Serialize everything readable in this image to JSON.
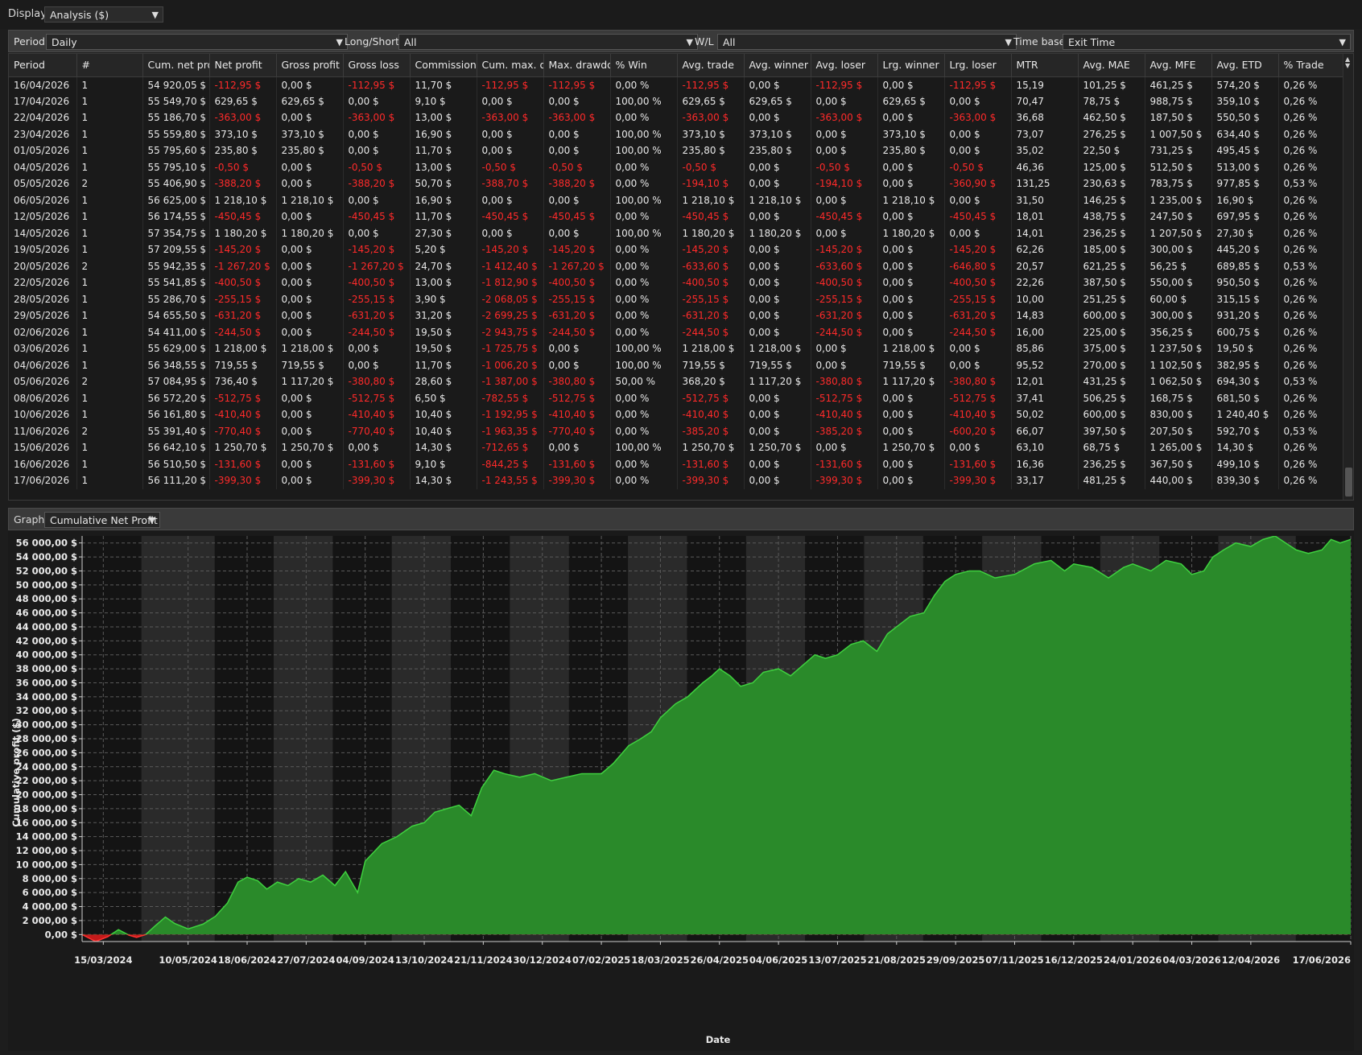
{
  "display": {
    "label": "Display",
    "value": "Analysis ($)"
  },
  "filters": {
    "period_label": "Period",
    "period_value": "Daily",
    "longshort_label": "Long/Short",
    "longshort_value": "All",
    "wl_label": "W/L",
    "wl_value": "All",
    "timebase_label": "Time base",
    "timebase_value": "Exit Time"
  },
  "table": {
    "columns": [
      "Period",
      "#",
      "Cum. net pro",
      "Net profit",
      "Gross profit",
      "Gross loss",
      "Commission",
      "Cum. max. dr",
      "Max. drawdow",
      "% Win",
      "Avg. trade",
      "Avg. winner",
      "Avg. loser",
      "Lrg. winner",
      "Lrg. loser",
      "MTR",
      "Avg. MAE",
      "Avg. MFE",
      "Avg. ETD",
      "% Trade"
    ],
    "rows": [
      [
        "16/04/2026",
        "1",
        "54 920,05 $",
        "-112,95 $",
        "0,00 $",
        "-112,95 $",
        "11,70 $",
        "-112,95 $",
        "-112,95 $",
        "0,00 %",
        "-112,95 $",
        "0,00 $",
        "-112,95 $",
        "0,00 $",
        "-112,95 $",
        "15,19",
        "101,25 $",
        "461,25 $",
        "574,20 $",
        "0,26 %"
      ],
      [
        "17/04/2026",
        "1",
        "55 549,70 $",
        "629,65 $",
        "629,65 $",
        "0,00 $",
        "9,10 $",
        "0,00 $",
        "0,00 $",
        "100,00 %",
        "629,65 $",
        "629,65 $",
        "0,00 $",
        "629,65 $",
        "0,00 $",
        "70,47",
        "78,75 $",
        "988,75 $",
        "359,10 $",
        "0,26 %"
      ],
      [
        "22/04/2026",
        "1",
        "55 186,70 $",
        "-363,00 $",
        "0,00 $",
        "-363,00 $",
        "13,00 $",
        "-363,00 $",
        "-363,00 $",
        "0,00 %",
        "-363,00 $",
        "0,00 $",
        "-363,00 $",
        "0,00 $",
        "-363,00 $",
        "36,68",
        "462,50 $",
        "187,50 $",
        "550,50 $",
        "0,26 %"
      ],
      [
        "23/04/2026",
        "1",
        "55 559,80 $",
        "373,10 $",
        "373,10 $",
        "0,00 $",
        "16,90 $",
        "0,00 $",
        "0,00 $",
        "100,00 %",
        "373,10 $",
        "373,10 $",
        "0,00 $",
        "373,10 $",
        "0,00 $",
        "73,07",
        "276,25 $",
        "1 007,50 $",
        "634,40 $",
        "0,26 %"
      ],
      [
        "01/05/2026",
        "1",
        "55 795,60 $",
        "235,80 $",
        "235,80 $",
        "0,00 $",
        "11,70 $",
        "0,00 $",
        "0,00 $",
        "100,00 %",
        "235,80 $",
        "235,80 $",
        "0,00 $",
        "235,80 $",
        "0,00 $",
        "35,02",
        "22,50 $",
        "731,25 $",
        "495,45 $",
        "0,26 %"
      ],
      [
        "04/05/2026",
        "1",
        "55 795,10 $",
        "-0,50 $",
        "0,00 $",
        "-0,50 $",
        "13,00 $",
        "-0,50 $",
        "-0,50 $",
        "0,00 %",
        "-0,50 $",
        "0,00 $",
        "-0,50 $",
        "0,00 $",
        "-0,50 $",
        "46,36",
        "125,00 $",
        "512,50 $",
        "513,00 $",
        "0,26 %"
      ],
      [
        "05/05/2026",
        "2",
        "55 406,90 $",
        "-388,20 $",
        "0,00 $",
        "-388,20 $",
        "50,70 $",
        "-388,70 $",
        "-388,20 $",
        "0,00 %",
        "-194,10 $",
        "0,00 $",
        "-194,10 $",
        "0,00 $",
        "-360,90 $",
        "131,25",
        "230,63 $",
        "783,75 $",
        "977,85 $",
        "0,53 %"
      ],
      [
        "06/05/2026",
        "1",
        "56 625,00 $",
        "1 218,10 $",
        "1 218,10 $",
        "0,00 $",
        "16,90 $",
        "0,00 $",
        "0,00 $",
        "100,00 %",
        "1 218,10 $",
        "1 218,10 $",
        "0,00 $",
        "1 218,10 $",
        "0,00 $",
        "31,50",
        "146,25 $",
        "1 235,00 $",
        "16,90 $",
        "0,26 %"
      ],
      [
        "12/05/2026",
        "1",
        "56 174,55 $",
        "-450,45 $",
        "0,00 $",
        "-450,45 $",
        "11,70 $",
        "-450,45 $",
        "-450,45 $",
        "0,00 %",
        "-450,45 $",
        "0,00 $",
        "-450,45 $",
        "0,00 $",
        "-450,45 $",
        "18,01",
        "438,75 $",
        "247,50 $",
        "697,95 $",
        "0,26 %"
      ],
      [
        "14/05/2026",
        "1",
        "57 354,75 $",
        "1 180,20 $",
        "1 180,20 $",
        "0,00 $",
        "27,30 $",
        "0,00 $",
        "0,00 $",
        "100,00 %",
        "1 180,20 $",
        "1 180,20 $",
        "0,00 $",
        "1 180,20 $",
        "0,00 $",
        "14,01",
        "236,25 $",
        "1 207,50 $",
        "27,30 $",
        "0,26 %"
      ],
      [
        "19/05/2026",
        "1",
        "57 209,55 $",
        "-145,20 $",
        "0,00 $",
        "-145,20 $",
        "5,20 $",
        "-145,20 $",
        "-145,20 $",
        "0,00 %",
        "-145,20 $",
        "0,00 $",
        "-145,20 $",
        "0,00 $",
        "-145,20 $",
        "62,26",
        "185,00 $",
        "300,00 $",
        "445,20 $",
        "0,26 %"
      ],
      [
        "20/05/2026",
        "2",
        "55 942,35 $",
        "-1 267,20 $",
        "0,00 $",
        "-1 267,20 $",
        "24,70 $",
        "-1 412,40 $",
        "-1 267,20 $",
        "0,00 %",
        "-633,60 $",
        "0,00 $",
        "-633,60 $",
        "0,00 $",
        "-646,80 $",
        "20,57",
        "621,25 $",
        "56,25 $",
        "689,85 $",
        "0,53 %"
      ],
      [
        "22/05/2026",
        "1",
        "55 541,85 $",
        "-400,50 $",
        "0,00 $",
        "-400,50 $",
        "13,00 $",
        "-1 812,90 $",
        "-400,50 $",
        "0,00 %",
        "-400,50 $",
        "0,00 $",
        "-400,50 $",
        "0,00 $",
        "-400,50 $",
        "22,26",
        "387,50 $",
        "550,00 $",
        "950,50 $",
        "0,26 %"
      ],
      [
        "28/05/2026",
        "1",
        "55 286,70 $",
        "-255,15 $",
        "0,00 $",
        "-255,15 $",
        "3,90 $",
        "-2 068,05 $",
        "-255,15 $",
        "0,00 %",
        "-255,15 $",
        "0,00 $",
        "-255,15 $",
        "0,00 $",
        "-255,15 $",
        "10,00",
        "251,25 $",
        "60,00 $",
        "315,15 $",
        "0,26 %"
      ],
      [
        "29/05/2026",
        "1",
        "54 655,50 $",
        "-631,20 $",
        "0,00 $",
        "-631,20 $",
        "31,20 $",
        "-2 699,25 $",
        "-631,20 $",
        "0,00 %",
        "-631,20 $",
        "0,00 $",
        "-631,20 $",
        "0,00 $",
        "-631,20 $",
        "14,83",
        "600,00 $",
        "300,00 $",
        "931,20 $",
        "0,26 %"
      ],
      [
        "02/06/2026",
        "1",
        "54 411,00 $",
        "-244,50 $",
        "0,00 $",
        "-244,50 $",
        "19,50 $",
        "-2 943,75 $",
        "-244,50 $",
        "0,00 %",
        "-244,50 $",
        "0,00 $",
        "-244,50 $",
        "0,00 $",
        "-244,50 $",
        "16,00",
        "225,00 $",
        "356,25 $",
        "600,75 $",
        "0,26 %"
      ],
      [
        "03/06/2026",
        "1",
        "55 629,00 $",
        "1 218,00 $",
        "1 218,00 $",
        "0,00 $",
        "19,50 $",
        "-1 725,75 $",
        "0,00 $",
        "100,00 %",
        "1 218,00 $",
        "1 218,00 $",
        "0,00 $",
        "1 218,00 $",
        "0,00 $",
        "85,86",
        "375,00 $",
        "1 237,50 $",
        "19,50 $",
        "0,26 %"
      ],
      [
        "04/06/2026",
        "1",
        "56 348,55 $",
        "719,55 $",
        "719,55 $",
        "0,00 $",
        "11,70 $",
        "-1 006,20 $",
        "0,00 $",
        "100,00 %",
        "719,55 $",
        "719,55 $",
        "0,00 $",
        "719,55 $",
        "0,00 $",
        "95,52",
        "270,00 $",
        "1 102,50 $",
        "382,95 $",
        "0,26 %"
      ],
      [
        "05/06/2026",
        "2",
        "57 084,95 $",
        "736,40 $",
        "1 117,20 $",
        "-380,80 $",
        "28,60 $",
        "-1 387,00 $",
        "-380,80 $",
        "50,00 %",
        "368,20 $",
        "1 117,20 $",
        "-380,80 $",
        "1 117,20 $",
        "-380,80 $",
        "12,01",
        "431,25 $",
        "1 062,50 $",
        "694,30 $",
        "0,53 %"
      ],
      [
        "08/06/2026",
        "1",
        "56 572,20 $",
        "-512,75 $",
        "0,00 $",
        "-512,75 $",
        "6,50 $",
        "-782,55 $",
        "-512,75 $",
        "0,00 %",
        "-512,75 $",
        "0,00 $",
        "-512,75 $",
        "0,00 $",
        "-512,75 $",
        "37,41",
        "506,25 $",
        "168,75 $",
        "681,50 $",
        "0,26 %"
      ],
      [
        "10/06/2026",
        "1",
        "56 161,80 $",
        "-410,40 $",
        "0,00 $",
        "-410,40 $",
        "10,40 $",
        "-1 192,95 $",
        "-410,40 $",
        "0,00 %",
        "-410,40 $",
        "0,00 $",
        "-410,40 $",
        "0,00 $",
        "-410,40 $",
        "50,02",
        "600,00 $",
        "830,00 $",
        "1 240,40 $",
        "0,26 %"
      ],
      [
        "11/06/2026",
        "2",
        "55 391,40 $",
        "-770,40 $",
        "0,00 $",
        "-770,40 $",
        "10,40 $",
        "-1 963,35 $",
        "-770,40 $",
        "0,00 %",
        "-385,20 $",
        "0,00 $",
        "-385,20 $",
        "0,00 $",
        "-600,20 $",
        "66,07",
        "397,50 $",
        "207,50 $",
        "592,70 $",
        "0,53 %"
      ],
      [
        "15/06/2026",
        "1",
        "56 642,10 $",
        "1 250,70 $",
        "1 250,70 $",
        "0,00 $",
        "14,30 $",
        "-712,65 $",
        "0,00 $",
        "100,00 %",
        "1 250,70 $",
        "1 250,70 $",
        "0,00 $",
        "1 250,70 $",
        "0,00 $",
        "63,10",
        "68,75 $",
        "1 265,00 $",
        "14,30 $",
        "0,26 %"
      ],
      [
        "16/06/2026",
        "1",
        "56 510,50 $",
        "-131,60 $",
        "0,00 $",
        "-131,60 $",
        "9,10 $",
        "-844,25 $",
        "-131,60 $",
        "0,00 %",
        "-131,60 $",
        "0,00 $",
        "-131,60 $",
        "0,00 $",
        "-131,60 $",
        "16,36",
        "236,25 $",
        "367,50 $",
        "499,10 $",
        "0,26 %"
      ],
      [
        "17/06/2026",
        "1",
        "56 111,20 $",
        "-399,30 $",
        "0,00 $",
        "-399,30 $",
        "14,30 $",
        "-1 243,55 $",
        "-399,30 $",
        "0,00 %",
        "-399,30 $",
        "0,00 $",
        "-399,30 $",
        "0,00 $",
        "-399,30 $",
        "33,17",
        "481,25 $",
        "440,00 $",
        "839,30 $",
        "0,26 %"
      ]
    ]
  },
  "graph": {
    "label": "Graph",
    "value": "Cumulative Net Profit"
  },
  "chart_data": {
    "type": "area",
    "ylabel": "Cumulative profit ($)",
    "xlabel": "Date",
    "ylim": [
      -1000,
      57000
    ],
    "y_ticks": [
      "0,00 $",
      "2 000,00 $",
      "4 000,00 $",
      "6 000,00 $",
      "8 000,00 $",
      "10 000,00 $",
      "12 000,00 $",
      "14 000,00 $",
      "16 000,00 $",
      "18 000,00 $",
      "20 000,00 $",
      "22 000,00 $",
      "24 000,00 $",
      "26 000,00 $",
      "28 000,00 $",
      "30 000,00 $",
      "32 000,00 $",
      "34 000,00 $",
      "36 000,00 $",
      "38 000,00 $",
      "40 000,00 $",
      "42 000,00 $",
      "44 000,00 $",
      "46 000,00 $",
      "48 000,00 $",
      "50 000,00 $",
      "52 000,00 $",
      "54 000,00 $",
      "56 000,00 $"
    ],
    "x_ticks": [
      "15/03/2024",
      "10/05/2024",
      "18/06/2024",
      "27/07/2024",
      "04/09/2024",
      "13/10/2024",
      "21/11/2024",
      "30/12/2024",
      "07/02/2025",
      "18/03/2025",
      "26/04/2025",
      "04/06/2025",
      "13/07/2025",
      "21/08/2025",
      "29/09/2025",
      "07/11/2025",
      "16/12/2025",
      "24/01/2026",
      "04/03/2026",
      "12/04/2026",
      "17/06/2026"
    ],
    "x_range": [
      "2024-03-01",
      "2026-06-17"
    ],
    "grid": true,
    "series": [
      {
        "dates": [
          "2024-03-01",
          "2024-03-10",
          "2024-03-18",
          "2024-03-25",
          "2024-04-01",
          "2024-04-06",
          "2024-04-12",
          "2024-04-18",
          "2024-04-25",
          "2024-05-01",
          "2024-05-10",
          "2024-05-20",
          "2024-05-28",
          "2024-06-05",
          "2024-06-12",
          "2024-06-18",
          "2024-06-25",
          "2024-07-01",
          "2024-07-08",
          "2024-07-15",
          "2024-07-22",
          "2024-07-30",
          "2024-08-07",
          "2024-08-15",
          "2024-08-22",
          "2024-08-30",
          "2024-09-04",
          "2024-09-15",
          "2024-09-25",
          "2024-10-05",
          "2024-10-13",
          "2024-10-20",
          "2024-10-28",
          "2024-11-05",
          "2024-11-13",
          "2024-11-20",
          "2024-11-28",
          "2024-12-05",
          "2024-12-15",
          "2024-12-25",
          "2025-01-05",
          "2025-01-15",
          "2025-01-25",
          "2025-02-07",
          "2025-02-15",
          "2025-02-25",
          "2025-03-05",
          "2025-03-12",
          "2025-03-18",
          "2025-03-28",
          "2025-04-05",
          "2025-04-15",
          "2025-04-21",
          "2025-04-26",
          "2025-05-03",
          "2025-05-10",
          "2025-05-18",
          "2025-05-25",
          "2025-06-04",
          "2025-06-12",
          "2025-06-20",
          "2025-06-28",
          "2025-07-05",
          "2025-07-13",
          "2025-07-22",
          "2025-07-30",
          "2025-08-08",
          "2025-08-15",
          "2025-08-21",
          "2025-08-30",
          "2025-09-08",
          "2025-09-15",
          "2025-09-22",
          "2025-09-29",
          "2025-10-08",
          "2025-10-15",
          "2025-10-25",
          "2025-11-07",
          "2025-11-20",
          "2025-12-01",
          "2025-12-10",
          "2025-12-16",
          "2025-12-28",
          "2026-01-08",
          "2026-01-18",
          "2026-01-24",
          "2026-02-05",
          "2026-02-15",
          "2026-02-25",
          "2026-03-04",
          "2026-03-12",
          "2026-03-18",
          "2026-03-25",
          "2026-04-02",
          "2026-04-12",
          "2026-04-20",
          "2026-04-28",
          "2026-05-05",
          "2026-05-12",
          "2026-05-20",
          "2026-05-29",
          "2026-06-04",
          "2026-06-10",
          "2026-06-17"
        ],
        "values": [
          0,
          -1000,
          -300,
          700,
          -100,
          -400,
          0,
          1200,
          2500,
          1600,
          800,
          1500,
          2600,
          4500,
          7500,
          8200,
          7700,
          6500,
          7500,
          7000,
          8000,
          7500,
          8500,
          7000,
          9000,
          6000,
          10500,
          13000,
          14000,
          15500,
          16000,
          17500,
          18000,
          18500,
          17000,
          21000,
          23500,
          23000,
          22500,
          23000,
          22000,
          22500,
          23000,
          23000,
          24500,
          27000,
          28000,
          29000,
          31000,
          33000,
          34000,
          36000,
          37000,
          38000,
          37000,
          35500,
          36000,
          37500,
          38000,
          37000,
          38500,
          40000,
          39500,
          40000,
          41500,
          42000,
          40500,
          43000,
          44000,
          45500,
          46000,
          48500,
          50500,
          51500,
          52000,
          52000,
          51000,
          51500,
          53000,
          53500,
          52000,
          53000,
          52500,
          51000,
          52500,
          53000,
          52000,
          53500,
          53000,
          51500,
          52000,
          54000,
          55000,
          56000,
          55500,
          56500,
          57000,
          56000,
          55000,
          54500,
          55000,
          56500,
          56000,
          56500
        ]
      }
    ]
  }
}
